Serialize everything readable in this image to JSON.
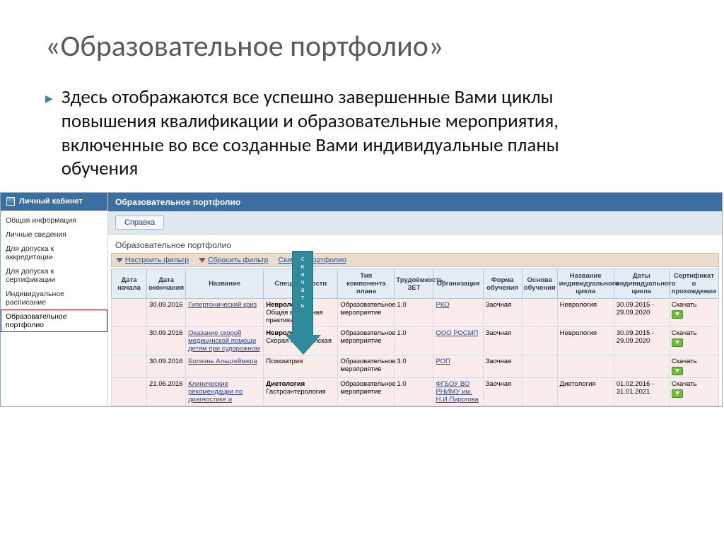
{
  "slide": {
    "title": "«Образовательное портфолио»",
    "bullet": "Здесь отображаются все успешно завершенные Вами циклы повышения квалификации и образовательные мероприятия, включенные во все созданные Вами индивидуальные планы обучения",
    "arrow_label": "скачать"
  },
  "sidebar": {
    "header": "Личный кабинет",
    "items": [
      "Общая информация",
      "Личные сведения",
      "Для допуска к аккредитации",
      "Для допуска к сертификации",
      "Индивидуальное расписание",
      "Образовательное портфолио"
    ],
    "active_index": 5
  },
  "main": {
    "header": "Образовательное портфолио",
    "help_btn": "Справка",
    "section_label": "Образовательное портфолио",
    "filters": {
      "configure": "Настроить фильтр",
      "reset": "Сбросить фильтр",
      "download_all": "Скачать портфолио"
    },
    "columns": [
      "Дата начала",
      "Дата окончания",
      "Название",
      "Специальности",
      "Тип компонента плана",
      "Трудоёмкость, ЗЕТ",
      "Организация",
      "Форма обучения",
      "Основа обучения",
      "Название индивидуального цикла",
      "Даты индивидуального цикла",
      "Сертификат о прохождении"
    ],
    "col_widths": [
      "50",
      "55",
      "110",
      "105",
      "80",
      "55",
      "70",
      "55",
      "50",
      "80",
      "78",
      "70"
    ],
    "rows": [
      {
        "start": "",
        "end": "30.09.2016",
        "title": "Гипертонический криз",
        "specs_bold": "Неврология",
        "specs_rest": "Общая врачебная практика",
        "type": "Образовательное мероприятие",
        "zet": "1.0",
        "org": "РКО",
        "form": "Заочная",
        "basis": "",
        "cycle_name": "Неврология",
        "cycle_dates": "30.09.2015 - 29.09.2020",
        "cert": "Скачать"
      },
      {
        "start": "",
        "end": "30.09.2016",
        "title": "Оказание скорой медицинской помощи детям при судорожном",
        "specs_bold": "Неврология",
        "specs_rest": "Скорая медицинская",
        "type": "Образовательное мероприятие",
        "zet": "1.0",
        "org": "ООО РОСМП",
        "form": "Заочная",
        "basis": "",
        "cycle_name": "Неврология",
        "cycle_dates": "30.09.2015 - 29.09.2020",
        "cert": "Скачать"
      },
      {
        "start": "",
        "end": "30.09.2016",
        "title": "Болезнь Альцгеймера",
        "specs_bold": "",
        "specs_rest": "Психиатрия",
        "type": "Образовательное мероприятие",
        "zet": "3.0",
        "org": "РОП",
        "form": "Заочная",
        "basis": "",
        "cycle_name": "",
        "cycle_dates": "",
        "cert": "Скачать"
      },
      {
        "start": "",
        "end": "21.06.2016",
        "title": "Клинические рекомендации по диагностике и",
        "specs_bold": "Диетология",
        "specs_rest": "Гастроэнтерология",
        "type": "Образовательное мероприятие",
        "zet": "1.0",
        "org": "ФГБОУ ВО РНИМУ им. Н.И.Пирогова",
        "form": "Заочная",
        "basis": "",
        "cycle_name": "Диетология",
        "cycle_dates": "01.02.2016 - 31.01.2021",
        "cert": "Скачать"
      }
    ]
  }
}
